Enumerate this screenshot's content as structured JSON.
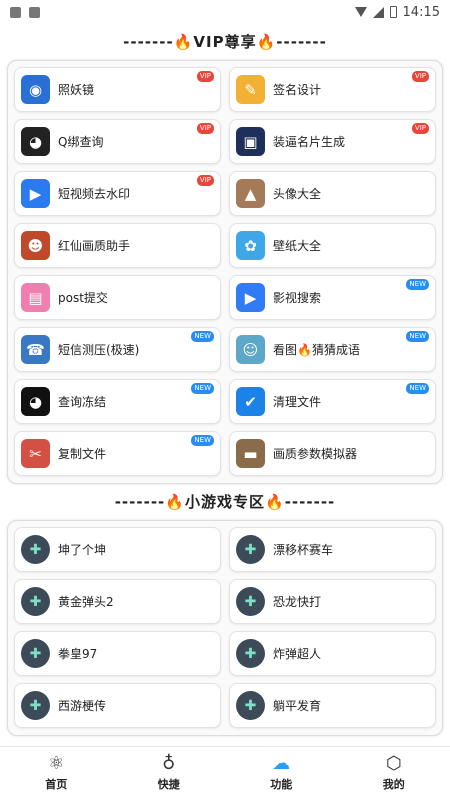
{
  "status": {
    "time": "14:15"
  },
  "vip_section": {
    "title": "VIP尊享",
    "items": [
      {
        "label": "照妖镜",
        "tag": "VIP",
        "tag_color": "red",
        "icon": "camera-icon",
        "glyph": "◉",
        "color": "#2a6fd6"
      },
      {
        "label": "签名设计",
        "tag": "VIP",
        "tag_color": "red",
        "icon": "image-pen-icon",
        "glyph": "✎",
        "color": "#f2b134"
      },
      {
        "label": "Q绑查询",
        "tag": "VIP",
        "tag_color": "red",
        "icon": "penguin-icon",
        "glyph": "◕",
        "color": "#222222"
      },
      {
        "label": "装逼名片生成",
        "tag": "VIP",
        "tag_color": "red",
        "icon": "picture-frame-icon",
        "glyph": "▣",
        "color": "#1e2f5c"
      },
      {
        "label": "短视频去水印",
        "tag": "VIP",
        "tag_color": "red",
        "icon": "video-camera-icon",
        "glyph": "▶",
        "color": "#2b7bf0"
      },
      {
        "label": "头像大全",
        "tag": "",
        "tag_color": "",
        "icon": "avatar-upload-icon",
        "glyph": "▲",
        "color": "#a57a59"
      },
      {
        "label": "红仙画质助手",
        "tag": "",
        "tag_color": "",
        "icon": "game-character-icon",
        "glyph": "☻",
        "color": "#c0492b"
      },
      {
        "label": "壁纸大全",
        "tag": "",
        "tag_color": "",
        "icon": "petal-icon",
        "glyph": "✿",
        "color": "#3fa7e8"
      },
      {
        "label": "post提交",
        "tag": "",
        "tag_color": "",
        "icon": "post-card-icon",
        "glyph": "▤",
        "color": "#f07fb0"
      },
      {
        "label": "影视搜索",
        "tag": "NEW",
        "tag_color": "blue",
        "icon": "movie-camera-icon",
        "glyph": "▶",
        "color": "#2f7cf6"
      },
      {
        "label": "短信测压(极速)",
        "tag": "NEW",
        "tag_color": "blue",
        "icon": "fax-icon",
        "glyph": "☎",
        "color": "#3a78c4"
      },
      {
        "label": "看图🔥猜猜成语",
        "tag": "NEW",
        "tag_color": "blue",
        "icon": "puzzle-picture-icon",
        "glyph": "☺",
        "color": "#5da7c9"
      },
      {
        "label": "查询冻结",
        "tag": "NEW",
        "tag_color": "blue",
        "icon": "qq-penguin-icon",
        "glyph": "◕",
        "color": "#111111"
      },
      {
        "label": "清理文件",
        "tag": "NEW",
        "tag_color": "blue",
        "icon": "shield-icon",
        "glyph": "✔",
        "color": "#1b83e8"
      },
      {
        "label": "复制文件",
        "tag": "NEW",
        "tag_color": "blue",
        "icon": "copy-scroll-icon",
        "glyph": "✂",
        "color": "#d55044"
      },
      {
        "label": "画质参数模拟器",
        "tag": "",
        "tag_color": "",
        "icon": "desk-icon",
        "glyph": "▬",
        "color": "#8a6b4a"
      }
    ]
  },
  "game_section": {
    "title": "小游戏专区",
    "items": [
      {
        "label": "坤了个坤",
        "icon": "gamepad-icon",
        "glyph": "✚"
      },
      {
        "label": "漂移杯赛车",
        "icon": "gamepad-icon",
        "glyph": "✚"
      },
      {
        "label": "黄金弹头2",
        "icon": "gamepad-icon",
        "glyph": "✚"
      },
      {
        "label": "恐龙快打",
        "icon": "gamepad-icon",
        "glyph": "✚"
      },
      {
        "label": "拳皇97",
        "icon": "gamepad-icon",
        "glyph": "✚"
      },
      {
        "label": "炸弹超人",
        "icon": "gamepad-icon",
        "glyph": "✚"
      },
      {
        "label": "西游梗传",
        "icon": "gamepad-icon",
        "glyph": "✚"
      },
      {
        "label": "躺平发育",
        "icon": "gamepad-icon",
        "glyph": "✚"
      }
    ]
  },
  "bottom_nav": [
    {
      "label": "首页",
      "icon": "atom-icon",
      "glyph": "⚛",
      "active": false
    },
    {
      "label": "快捷",
      "icon": "planet-icon",
      "glyph": "♁",
      "active": false
    },
    {
      "label": "功能",
      "icon": "cloud-icon",
      "glyph": "☁",
      "active": true
    },
    {
      "label": "我的",
      "icon": "cube-icon",
      "glyph": "⬡",
      "active": false
    }
  ]
}
